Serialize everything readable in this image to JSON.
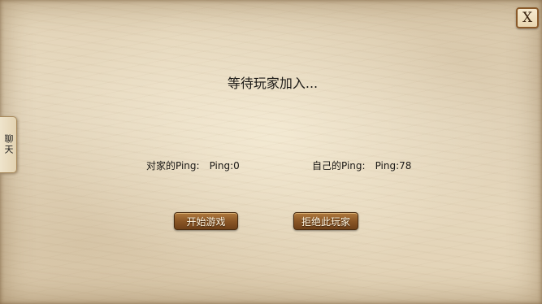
{
  "dialog": {
    "title": "等待玩家加入..."
  },
  "close_button": {
    "label": "X"
  },
  "chat_tab": {
    "label": "聊天"
  },
  "ping": {
    "opponent_label": "对家的Ping:",
    "opponent_value": "Ping:0",
    "self_label": "自己的Ping:",
    "self_value": "Ping:78"
  },
  "buttons": {
    "start_game": "开始游戏",
    "reject_player": "拒绝此玩家"
  },
  "colors": {
    "parchment": "#e6d8bd",
    "button_brown": "#8a5626",
    "button_text": "#fff5e0",
    "text": "#1c1a17"
  }
}
